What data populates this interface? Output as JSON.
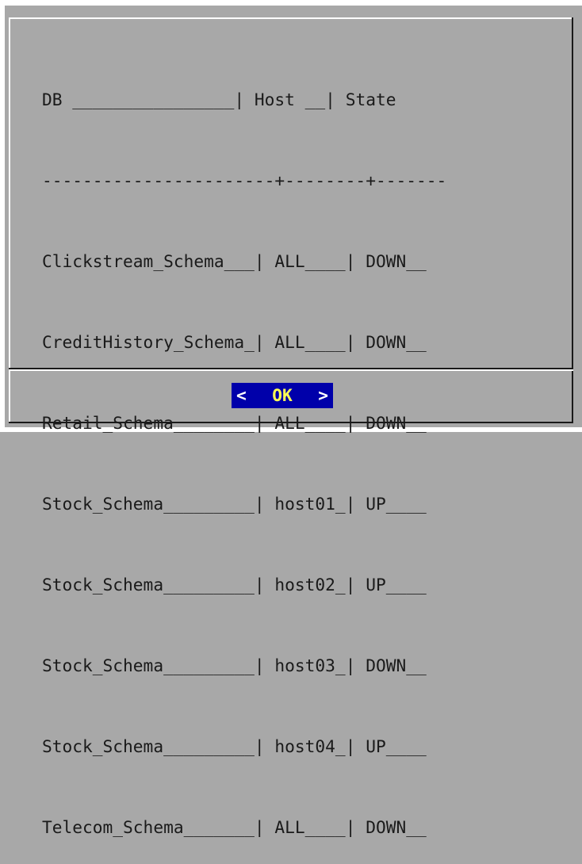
{
  "table": {
    "header": {
      "db": "DB ________________|",
      "host": " Host __|",
      "state": " State"
    },
    "separator": "-----------------------+--------+-------",
    "rows": [
      {
        "db": "Clickstream_Schema___|",
        "host": " ALL____|",
        "state": " DOWN__"
      },
      {
        "db": "CreditHistory_Schema_|",
        "host": " ALL____|",
        "state": " DOWN__"
      },
      {
        "db": "Retail_Schema________|",
        "host": " ALL____|",
        "state": " DOWN__"
      },
      {
        "db": "Stock_Schema_________|",
        "host": " host01_|",
        "state": " UP____"
      },
      {
        "db": "Stock_Schema_________|",
        "host": " host02_|",
        "state": " UP____"
      },
      {
        "db": "Stock_Schema_________|",
        "host": " host03_|",
        "state": " DOWN__"
      },
      {
        "db": "Stock_Schema_________|",
        "host": " host04_|",
        "state": " UP____"
      },
      {
        "db": "Telecom_Schema_______|",
        "host": " ALL____|",
        "state": " DOWN__"
      }
    ]
  },
  "button": {
    "left": "<",
    "label": "OK",
    "right": ">"
  },
  "colors": {
    "background": "#a8a8a8",
    "button_bg": "#0000aa",
    "button_label": "#ffff55",
    "text": "#1a1a1a"
  }
}
